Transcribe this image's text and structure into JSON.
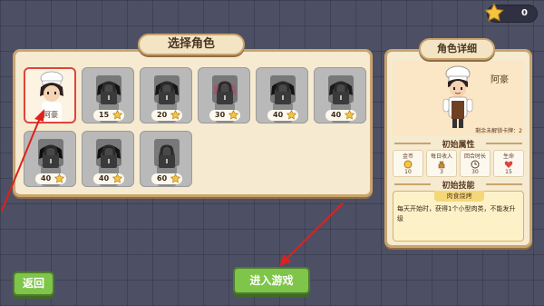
{
  "top_bar": {
    "stars": "0"
  },
  "select_panel": {
    "title": "选择角色",
    "characters": [
      {
        "name": "阿豪",
        "cost": "",
        "locked": false,
        "selected": true,
        "hair": "#2b2020"
      },
      {
        "name": "",
        "cost": "15",
        "locked": true,
        "selected": false,
        "hair": "#1e1e1e"
      },
      {
        "name": "",
        "cost": "20",
        "locked": true,
        "selected": false,
        "hair": "#222222"
      },
      {
        "name": "",
        "cost": "30",
        "locked": true,
        "selected": false,
        "hair": "#e88ea6"
      },
      {
        "name": "",
        "cost": "40",
        "locked": true,
        "selected": false,
        "hair": "#1e1e1e"
      },
      {
        "name": "",
        "cost": "40",
        "locked": true,
        "selected": false,
        "hair": "#2a2a2a"
      },
      {
        "name": "",
        "cost": "40",
        "locked": true,
        "selected": false,
        "hair": "#181818"
      },
      {
        "name": "",
        "cost": "40",
        "locked": true,
        "selected": false,
        "hair": "#202020"
      },
      {
        "name": "",
        "cost": "60",
        "locked": true,
        "selected": false,
        "hair": "#bdbdbd"
      }
    ]
  },
  "detail_panel": {
    "title": "角色详细",
    "name": "阿豪",
    "progress": "剩余未解锁卡牌：2",
    "attributes_title": "初始属性",
    "stats": [
      {
        "label": "金币",
        "icon": "coin-icon",
        "value": "10"
      },
      {
        "label": "每日收入",
        "icon": "money-bag-icon",
        "value": "3"
      },
      {
        "label": "回合时长",
        "icon": "clock-icon",
        "value": "30"
      },
      {
        "label": "生命",
        "icon": "heart-icon",
        "value": "15"
      }
    ],
    "skills_title": "初始技能",
    "skill": {
      "name": "肉食烧烤",
      "description": "每天开始时，获得1个小型肉类，不能发升级"
    }
  },
  "buttons": {
    "back": "返回",
    "start": "进入游戏"
  },
  "colors": {
    "accent_green": "#7ec54a",
    "panel_bg": "#f6ead0",
    "panel_border": "#c9a46e",
    "selected_border": "#e0443c"
  }
}
